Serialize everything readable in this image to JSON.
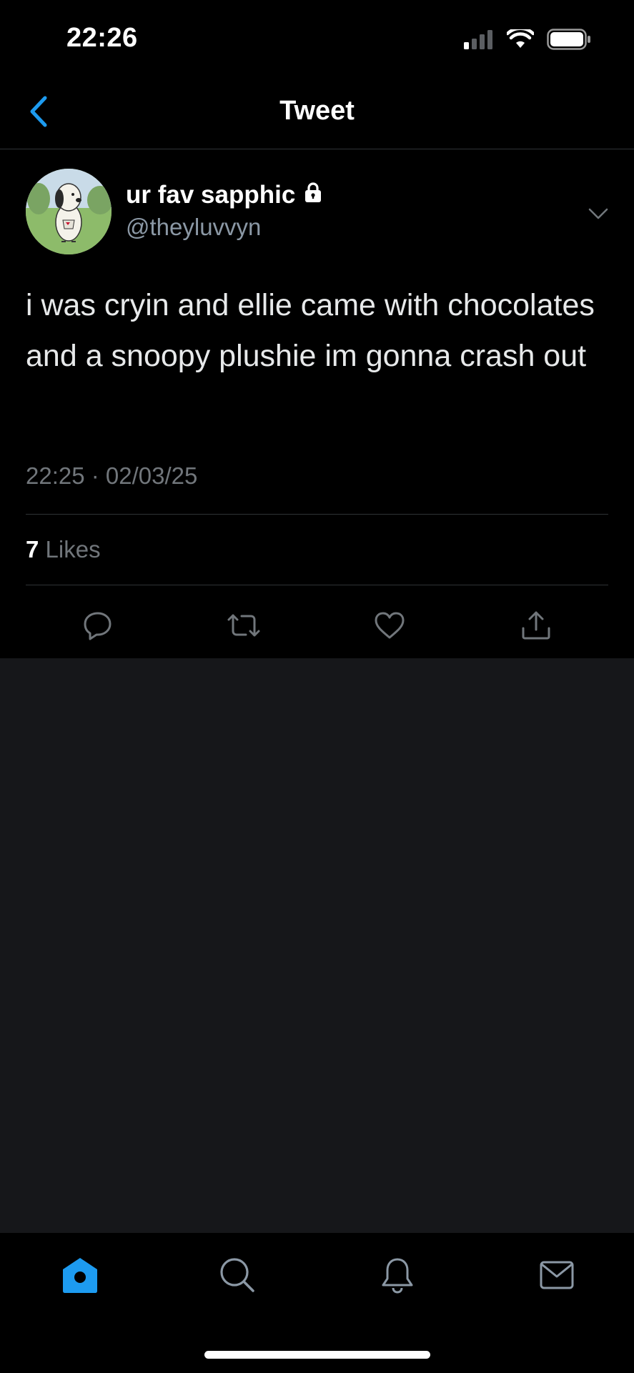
{
  "status_bar": {
    "time": "22:26"
  },
  "nav": {
    "title": "Tweet"
  },
  "tweet": {
    "author_name": "ur fav sapphic",
    "author_handle": "@theyluvvyn",
    "text": "i was cryin and ellie came with chocolates and a snoopy plushie im gonna crash out",
    "timestamp": "22:25 · 02/03/25",
    "likes_count": "7",
    "likes_label": "Likes"
  },
  "colors": {
    "accent": "#1d9bf0",
    "background": "#000000",
    "empty_background": "#16171a",
    "secondary_text": "#71767b",
    "divider": "#2f3336"
  },
  "icons": {
    "back": "chevron-left-icon",
    "lock": "lock-icon",
    "caret": "chevron-down-icon",
    "reply": "reply-icon",
    "retweet": "retweet-icon",
    "like": "heart-icon",
    "share": "share-icon",
    "tabs": [
      "home-icon",
      "search-icon",
      "bell-icon",
      "mail-icon"
    ]
  }
}
